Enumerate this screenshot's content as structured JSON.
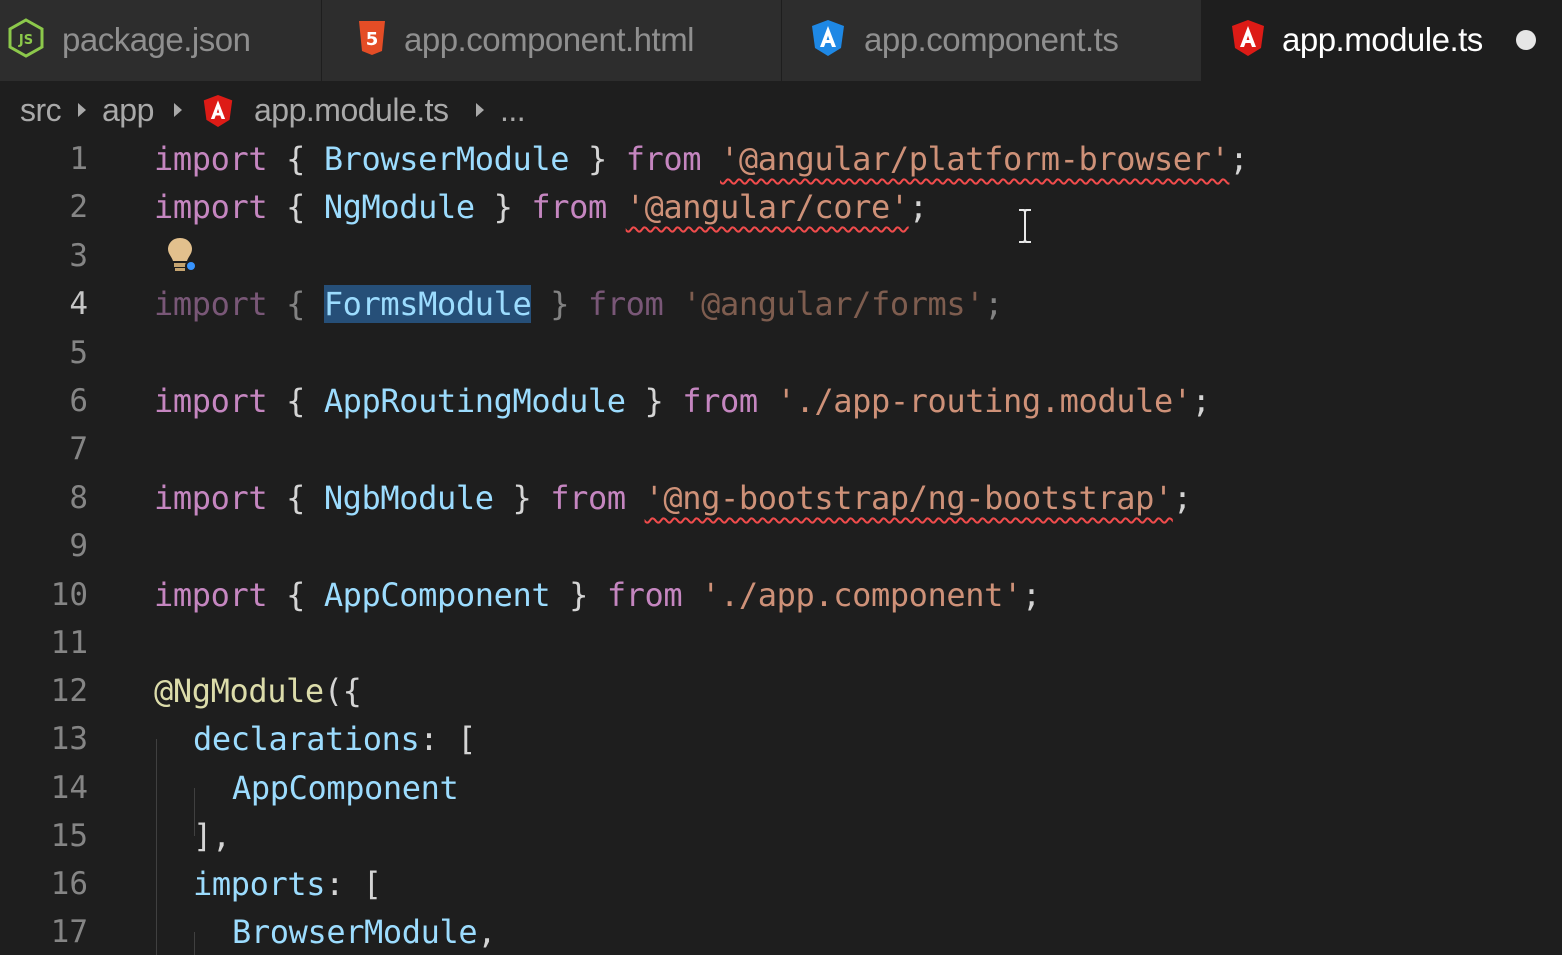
{
  "tabs": [
    {
      "label": "package.json",
      "icon": "nodejs-icon",
      "active": false
    },
    {
      "label": "app.component.html",
      "icon": "html5-icon",
      "active": false
    },
    {
      "label": "app.component.ts",
      "icon": "angular-icon",
      "active": false
    },
    {
      "label": "app.module.ts",
      "icon": "angular-icon",
      "active": true,
      "dirty": true
    }
  ],
  "breadcrumb": {
    "items": [
      "src",
      "app",
      "app.module.ts",
      "..."
    ]
  },
  "editor": {
    "current_line": 4,
    "line_numbers": [
      "1",
      "2",
      "3",
      "4",
      "5",
      "6",
      "7",
      "8",
      "9",
      "10",
      "11",
      "12",
      "13",
      "14",
      "15",
      "16",
      "17"
    ],
    "code": {
      "l1": {
        "kw1": "import",
        "p1": " { ",
        "id": "BrowserModule",
        "p2": " } ",
        "kw2": "from",
        "p3": " ",
        "str": "'@angular/platform-browser'",
        "p4": ";"
      },
      "l2": {
        "kw1": "import",
        "p1": " { ",
        "id": "NgModule",
        "p2": " } ",
        "kw2": "from",
        "p3": " ",
        "str": "'@angular/core'",
        "p4": ";"
      },
      "l4": {
        "kw1": "import",
        "p1": " { ",
        "id": "FormsModule",
        "p2": " } ",
        "kw2": "from",
        "p3": " ",
        "str": "'@angular/forms'",
        "p4": ";"
      },
      "l6": {
        "kw1": "import",
        "p1": " { ",
        "id": "AppRoutingModule",
        "p2": " } ",
        "kw2": "from",
        "p3": " ",
        "str": "'./app-routing.module'",
        "p4": ";"
      },
      "l8": {
        "kw1": "import",
        "p1": " { ",
        "id": "NgbModule",
        "p2": " } ",
        "kw2": "from",
        "p3": " ",
        "str": "'@ng-bootstrap/ng-bootstrap'",
        "p4": ";"
      },
      "l10": {
        "kw1": "import",
        "p1": " { ",
        "id": "AppComponent",
        "p2": " } ",
        "kw2": "from",
        "p3": " ",
        "str": "'./app.component'",
        "p4": ";"
      },
      "l12": {
        "dec": "@NgModule",
        "p1": "({"
      },
      "l13": {
        "id": "declarations",
        "p1": ": ["
      },
      "l14": {
        "id": "AppComponent"
      },
      "l15": {
        "p1": "],"
      },
      "l16": {
        "id": "imports",
        "p1": ": ["
      },
      "l17": {
        "id": "BrowserModule",
        "p1": ","
      }
    }
  },
  "colors": {
    "keyword": "#c586c0",
    "identifier": "#9cdcfe",
    "string": "#ce9178",
    "decorator": "#dcdcaa",
    "error_squiggle": "#f14c4c",
    "selection": "#264f78",
    "angular_red": "#dd1b16",
    "angular_blue": "#1e88e5",
    "html_orange": "#e44d26",
    "node_green": "#8cc84b"
  }
}
